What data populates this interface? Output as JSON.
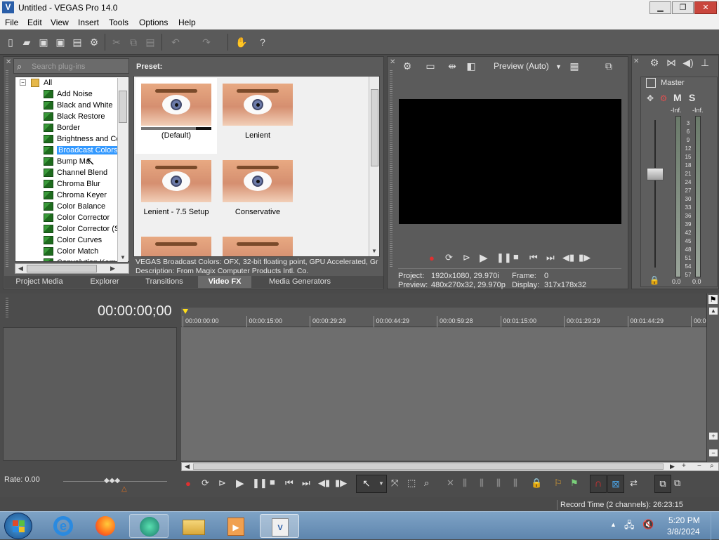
{
  "window": {
    "title": "Untitled - VEGAS Pro 14.0",
    "minimize": "▁",
    "maximize": "❐",
    "close": "✕"
  },
  "menu": [
    "File",
    "Edit",
    "View",
    "Insert",
    "Tools",
    "Options",
    "Help"
  ],
  "plugins": {
    "search_placeholder": "Search plug-ins",
    "root": "All",
    "items": [
      "Add Noise",
      "Black and White",
      "Black Restore",
      "Border",
      "Brightness and Co",
      "Broadcast Colors",
      "Bump Ma",
      "Channel Blend",
      "Chroma Blur",
      "Chroma Keyer",
      "Color Balance",
      "Color Corrector",
      "Color Corrector (S",
      "Color Curves",
      "Color Match",
      "Convolution Kerne"
    ],
    "selected": "Broadcast Colors"
  },
  "presets": {
    "header": "Preset:",
    "items": [
      "(Default)",
      "Lenient",
      "Lenient - 7.5 Setup",
      "Conservative"
    ],
    "description_line1": "VEGAS Broadcast Colors: OFX, 32-bit floating point, GPU Accelerated, Gr",
    "description_line2": "Description: From Magix Computer Products Intl. Co."
  },
  "tabs": [
    "Project Media",
    "Explorer",
    "Transitions",
    "Video FX",
    "Media Generators"
  ],
  "active_tab": "Video FX",
  "preview": {
    "mode": "Preview (Auto)",
    "project_label": "Project:",
    "project_value": "1920x1080, 29.970i",
    "preview_label": "Preview:",
    "preview_value": "480x270x32, 29.970p",
    "frame_label": "Frame:",
    "frame_value": "0",
    "display_label": "Display:",
    "display_value": "317x178x32"
  },
  "mixer": {
    "title": "Master",
    "m": "M",
    "s": "S",
    "inf_left": "-Inf.",
    "inf_right": "-Inf.",
    "scale": [
      "3",
      "6",
      "9",
      "12",
      "15",
      "18",
      "21",
      "24",
      "27",
      "30",
      "33",
      "36",
      "39",
      "42",
      "45",
      "48",
      "51",
      "54",
      "57"
    ],
    "val_left": "0.0",
    "val_right": "0.0"
  },
  "timeline": {
    "timecode": "00:00:00;00",
    "ruler": [
      "00:00:00:00",
      "00:00:15:00",
      "00:00:29:29",
      "00:00:44:29",
      "00:00:59:28",
      "00:01:15:00",
      "00:01:29:29",
      "00:01:44:29",
      "00:0"
    ],
    "rate": "Rate: 0.00",
    "record_time": "Record Time (2 channels): 26:23:15"
  },
  "taskbar": {
    "time": "5:20 PM",
    "date": "3/8/2024"
  }
}
